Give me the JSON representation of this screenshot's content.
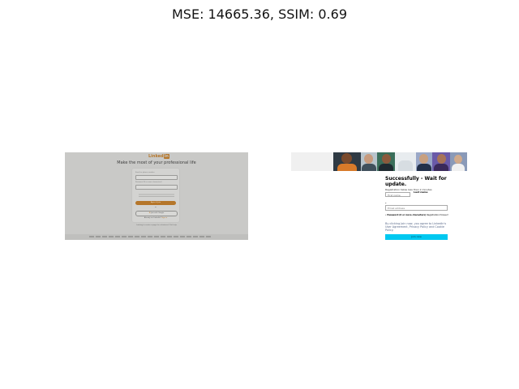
{
  "header": {
    "title": "MSE: 14665.36, SSIM: 0.69"
  },
  "left_panel": {
    "logo_text": "Linked",
    "logo_badge": "in",
    "headline": "Make the most of your professional life",
    "email_label": "Email or phone number",
    "password_label": "Password (6 or more characters)",
    "join_button": "Agree & Join",
    "or_text": "or",
    "google_button": "Join with Google",
    "google_glyph": "G",
    "already_text": "Already on LinkedIn?",
    "sign_in_link": "Sign in",
    "help_text": "Looking to create a page for a business? Get help"
  },
  "right_panel": {
    "form_title": "Successfully - Wait for update.",
    "form_subtitle": "Registration takes less than 2 minutes",
    "first_name_placeholder": "First name",
    "last_name_label": "Last name",
    "email_label": "*",
    "email_placeholder": "Email address",
    "password_label_bold": "Password (6 or more characters)",
    "password_label_rest": "Registration forever!",
    "password_prefix": "•",
    "agree_text": "By clicking Join now, you agree to LinkedIn's User Agreement, Privacy Policy and Cookie Policy.",
    "join_button": "Join now"
  },
  "colors": {
    "left_bg": "#c9c9c7",
    "left_accent": "#b5762a",
    "right_button": "#00c8f0"
  }
}
